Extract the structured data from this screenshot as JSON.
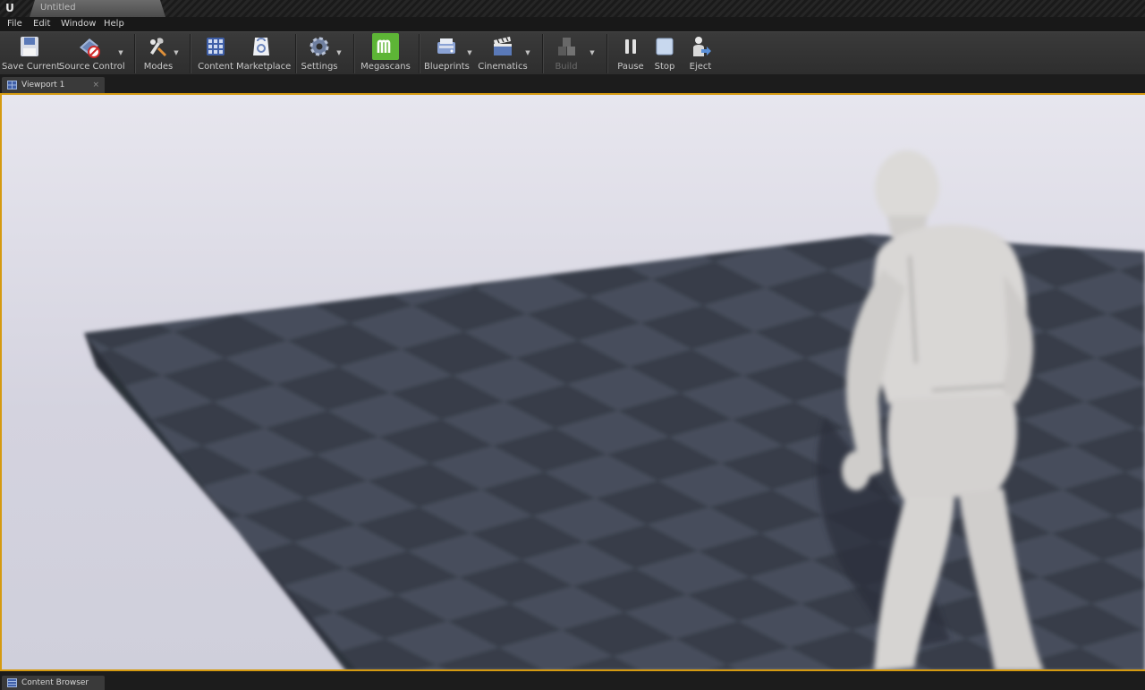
{
  "app": {
    "logo": "U",
    "document_tab": "Untitled"
  },
  "menu": {
    "items": [
      "File",
      "Edit",
      "Window",
      "Help"
    ]
  },
  "toolbar": {
    "save_current": "Save Current",
    "source_control": "Source Control",
    "modes": "Modes",
    "content": "Content",
    "marketplace": "Marketplace",
    "settings": "Settings",
    "megascans": "Megascans",
    "blueprints": "Blueprints",
    "cinematics": "Cinematics",
    "build": "Build",
    "pause": "Pause",
    "stop": "Stop",
    "eject": "Eject"
  },
  "viewport_tab": {
    "label": "Viewport 1",
    "close": "×"
  },
  "bottom_tab": {
    "label": "Content Browser"
  },
  "colors": {
    "accent": "#d59a10",
    "megascans_green": "#5db536",
    "floor": "#434a58",
    "mannequin": "#d8d6d4"
  },
  "icons": [
    "unreal-logo-icon",
    "save-icon",
    "source-control-icon",
    "modes-icon",
    "content-icon",
    "marketplace-icon",
    "settings-icon",
    "megascans-icon",
    "blueprints-icon",
    "cinematics-icon",
    "build-icon",
    "pause-icon",
    "stop-icon",
    "eject-icon",
    "viewport-icon",
    "content-browser-icon"
  ]
}
